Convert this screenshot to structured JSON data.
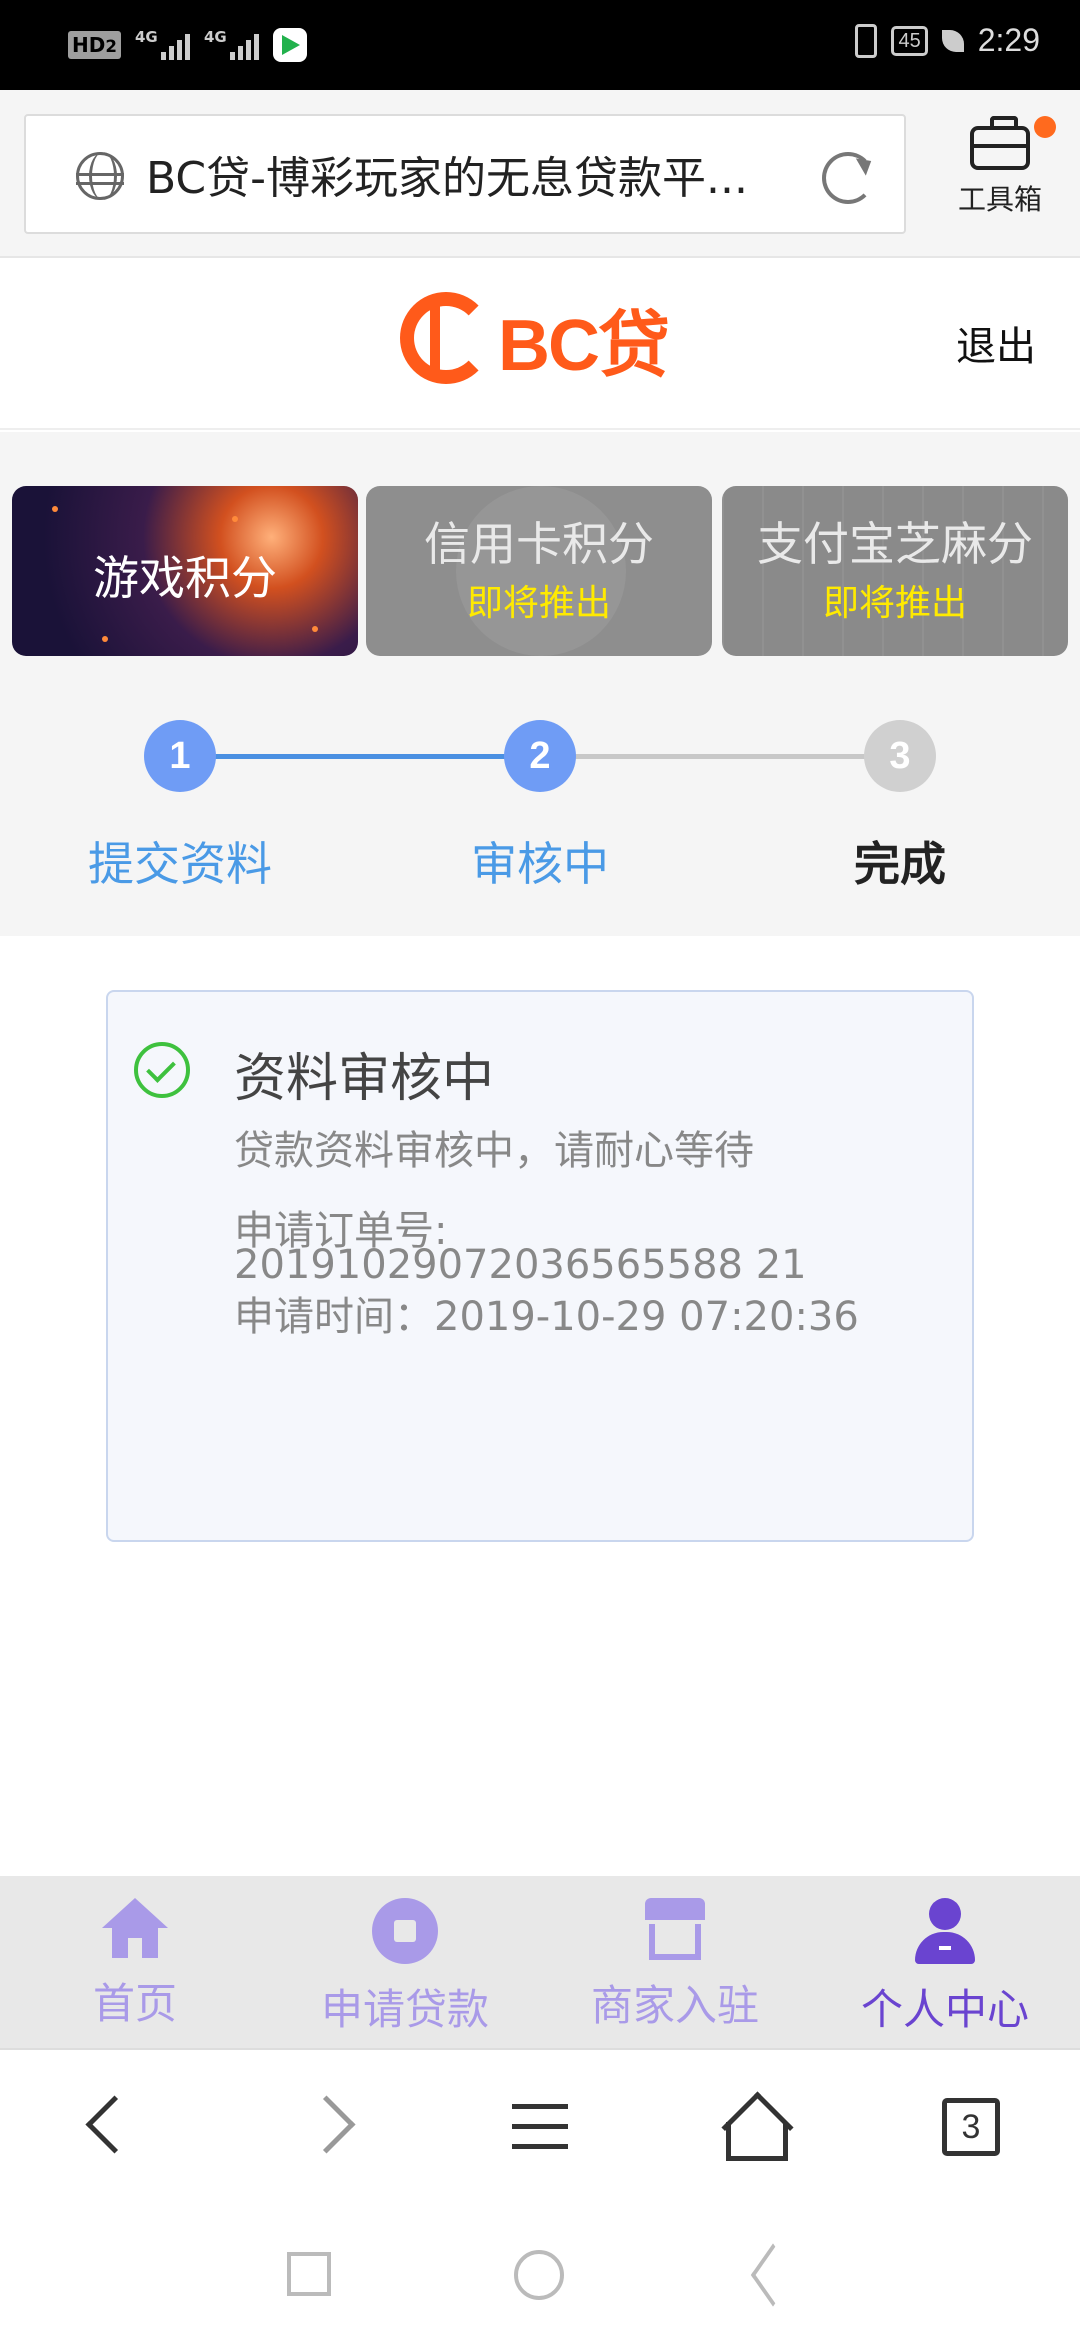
{
  "status_bar": {
    "hd_label": "HD",
    "hd_sub": "2",
    "net1": "4G",
    "net2": "4G",
    "battery": "45",
    "time": "2:29",
    "app_icon": "play-app-icon"
  },
  "browser": {
    "url_title": "BC贷-博彩玩家的无息贷款平...",
    "toolbox_label": "工具箱",
    "tab_count": "3",
    "icons": [
      "globe-icon",
      "reload-icon",
      "briefcase-icon"
    ]
  },
  "header": {
    "logo_text": "BC贷",
    "logout_label": "退出",
    "brand_color": "#ff5a1a"
  },
  "cards": [
    {
      "title": "游戏积分",
      "subtitle": ""
    },
    {
      "title": "信用卡积分",
      "subtitle": "即将推出"
    },
    {
      "title": "支付宝芝麻分",
      "subtitle": "即将推出"
    }
  ],
  "steps": [
    {
      "number": "1",
      "label": "提交资料",
      "state": "done"
    },
    {
      "number": "2",
      "label": "审核中",
      "state": "current"
    },
    {
      "number": "3",
      "label": "完成",
      "state": "pending"
    }
  ],
  "status_panel": {
    "title": "资料审核中",
    "message": "贷款资料审核中，请耐心等待",
    "order_label": "申请订单号:",
    "order_number": "20191029072036565588 21",
    "time_line": "申请时间：2019-10-29 07:20:36",
    "check_color": "#3ec13e"
  },
  "bottom_nav": {
    "items": [
      {
        "label": "首页",
        "icon": "home-icon"
      },
      {
        "label": "申请贷款",
        "icon": "apply-loan-icon"
      },
      {
        "label": "商家入驻",
        "icon": "shop-icon"
      },
      {
        "label": "个人中心",
        "icon": "user-icon",
        "active": true
      }
    ],
    "accent": "#6a44d0"
  }
}
